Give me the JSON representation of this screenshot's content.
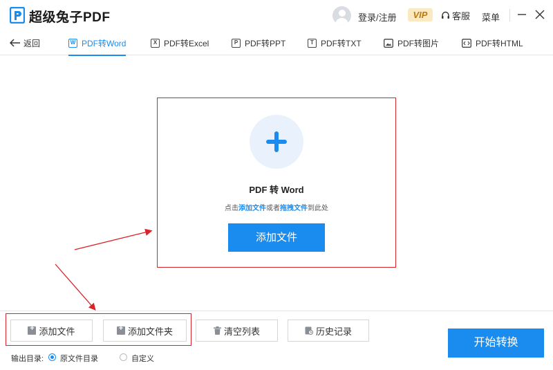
{
  "app": {
    "title": "超级兔子PDF"
  },
  "header": {
    "login_label": "登录/注册",
    "vip_label": "VIP",
    "service_label": "客服",
    "menu_label": "菜单"
  },
  "tabs": {
    "back_label": "返回",
    "items": [
      {
        "label": "PDF转Word",
        "icon": "W"
      },
      {
        "label": "PDF转Excel",
        "icon": "X"
      },
      {
        "label": "PDF转PPT",
        "icon": "P"
      },
      {
        "label": "PDF转TXT",
        "icon": "T"
      },
      {
        "label": "PDF转图片",
        "icon": "image-icon"
      },
      {
        "label": "PDF转HTML",
        "icon": "code-icon"
      }
    ],
    "active_index": 0
  },
  "dropzone": {
    "title": "PDF 转 Word",
    "hint_prefix": "点击",
    "hint_link1": "添加文件",
    "hint_mid": "或者",
    "hint_link2": "拖拽文件",
    "hint_suffix": "到此处",
    "add_button": "添加文件"
  },
  "bottom": {
    "add_file": "添加文件",
    "add_folder": "添加文件夹",
    "clear_list": "清空列表",
    "history": "历史记录",
    "start": "开始转换",
    "output_label": "输出目录:",
    "option_original": "原文件目录",
    "option_custom": "自定义",
    "selected_option": "原文件目录"
  },
  "colors": {
    "accent": "#1a8cf0",
    "annotation": "#d9232a"
  }
}
